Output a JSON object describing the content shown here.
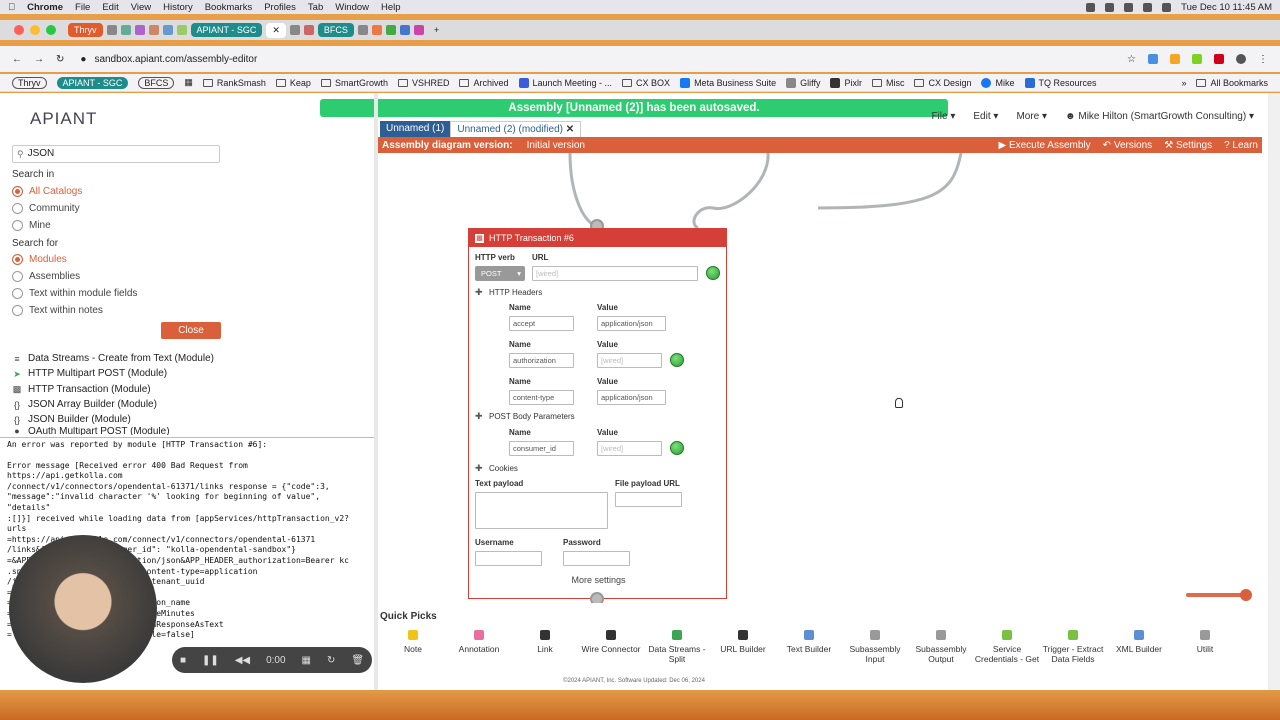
{
  "menubar": {
    "app": "Chrome",
    "items": [
      "File",
      "Edit",
      "View",
      "History",
      "Bookmarks",
      "Profiles",
      "Tab",
      "Window",
      "Help"
    ],
    "clock": "Tue Dec 10  11:45 AM"
  },
  "tabs": {
    "items": [
      {
        "label": "Thryv"
      },
      {
        "label": "APIANT - SGC"
      },
      {
        "label": "BFCS"
      }
    ]
  },
  "address": {
    "url": "sandbox.apiant.com/assembly-editor"
  },
  "bookmarks": {
    "items": [
      "RankSmash",
      "Keap",
      "SmartGrowth",
      "VSHRED",
      "Archived",
      "Launch Meeting - ...",
      "CX BOX",
      "Meta Business Suite",
      "Gliffy",
      "Pixlr",
      "Misc",
      "CX Design",
      "Mike",
      "TQ Resources"
    ],
    "badges": [
      "Thryv",
      "APIANT - SGC",
      "BFCS"
    ],
    "all": "All Bookmarks"
  },
  "app": {
    "logo": "APIANT",
    "autosave": "Assembly [Unnamed (2)] has been autosaved."
  },
  "sidebar": {
    "search_value": "JSON",
    "search_in_label": "Search in",
    "search_in": [
      {
        "label": "All Catalogs",
        "selected": true
      },
      {
        "label": "Community",
        "selected": false
      },
      {
        "label": "Mine",
        "selected": false
      }
    ],
    "search_for_label": "Search for",
    "search_for": [
      {
        "label": "Modules",
        "selected": true
      },
      {
        "label": "Assemblies",
        "selected": false
      },
      {
        "label": "Text within module fields",
        "selected": false
      },
      {
        "label": "Text within notes",
        "selected": false
      }
    ],
    "close_label": "Close",
    "modules": [
      "Data Streams - Create from Text (Module)",
      "HTTP Multipart POST (Module)",
      "HTTP Transaction (Module)",
      "JSON Array Builder (Module)",
      "JSON Builder (Module)",
      "OAuth Multipart POST (Module)"
    ]
  },
  "error": {
    "heading": "An error was reported by module [HTTP Transaction #6]:",
    "lines": [
      "Error message [Received error 400 Bad Request from https://api.getkolla.com",
      "/connect/v1/connectors/opendental-61371/links response = {\"code\":3,",
      "\"message\":\"invalid character '%' looking for beginning of value\", \"details\"",
      ":[]}] received while loading data from [appServices/httpTransaction_v2?urls",
      "=https://api.getkolla.com/connect/v1/connectors/opendental-61371",
      "/links&APP_PARAM_{\"consumer_id\": \"kolla-opendental-sandbox\"}",
      "=&APP_HEADER_accept=application/json&APP_HEADER_authorization=Bearer kc",
      ".snx4xqpt        qghfqq&APP_HEADER_content-type=application",
      "/json&           ngth=2500000&verb=POST&tenant_uuid",
      "=bdf             079c4&person_uuid",
      "=d1              4537&service_uuid=&connection_name",
      "=                 url=&username=&password=&cacheMinutes",
      "=                 ltAssemblyOnError=true&returnResponseAsText",
      "=                 true&returnResponseAsURLToFile=false]"
    ]
  },
  "player": {
    "time": "0:00"
  },
  "editor": {
    "tabs": [
      {
        "label": "Unnamed (1)"
      },
      {
        "label": "Unnamed (2) (modified)"
      }
    ],
    "menu": [
      "File",
      "Edit",
      "More",
      "Mike Hilton (SmartGrowth Consulting)"
    ],
    "version_label": "Assembly diagram version:",
    "version_value": "Initial version",
    "actions": [
      "Execute Assembly",
      "Versions",
      "Settings",
      "Learn"
    ]
  },
  "node": {
    "title": "HTTP Transaction #6",
    "verb_label": "HTTP verb",
    "verb_value": "POST",
    "url_label": "URL",
    "url_value": "[wired]",
    "headers_label": "HTTP Headers",
    "name_label": "Name",
    "value_label": "Value",
    "headers": [
      {
        "name": "accept",
        "value": "application/json",
        "wired": false
      },
      {
        "name": "authorization",
        "value": "[wired]",
        "wired": true
      },
      {
        "name": "content-type",
        "value": "application/json",
        "wired": false
      }
    ],
    "body_label": "POST Body Parameters",
    "body": [
      {
        "name": "consumer_id",
        "value": "[wired]",
        "wired": true
      }
    ],
    "cookies_label": "Cookies",
    "text_payload_label": "Text payload",
    "file_payload_label": "File payload URL",
    "username_label": "Username",
    "password_label": "Password",
    "more_label": "More settings"
  },
  "quick_picks": {
    "title": "Quick Picks",
    "items": [
      {
        "label": "Note",
        "color": "#f0c419"
      },
      {
        "label": "Annotation",
        "color": "#e86fa0"
      },
      {
        "label": "Link",
        "color": "#333333"
      },
      {
        "label": "Wire Connector",
        "color": "#333333"
      },
      {
        "label": "Data Streams - Split",
        "color": "#3aa655"
      },
      {
        "label": "URL Builder",
        "color": "#333333"
      },
      {
        "label": "Text Builder",
        "color": "#5b8fd1"
      },
      {
        "label": "Subassembly Input",
        "color": "#999999"
      },
      {
        "label": "Subassembly Output",
        "color": "#999999"
      },
      {
        "label": "Service Credentials - Get",
        "color": "#7ac142"
      },
      {
        "label": "Trigger - Extract Data Fields",
        "color": "#7ac142"
      },
      {
        "label": "XML Builder",
        "color": "#5b8fd1"
      },
      {
        "label": "Utilit",
        "color": "#999999"
      }
    ]
  },
  "footer": "©2024 APIANT, Inc.   Software Updated: Dec 06, 2024",
  "colors": {
    "accent": "#d9603b",
    "autosave": "#2ecc71",
    "node": "#d63f37"
  }
}
